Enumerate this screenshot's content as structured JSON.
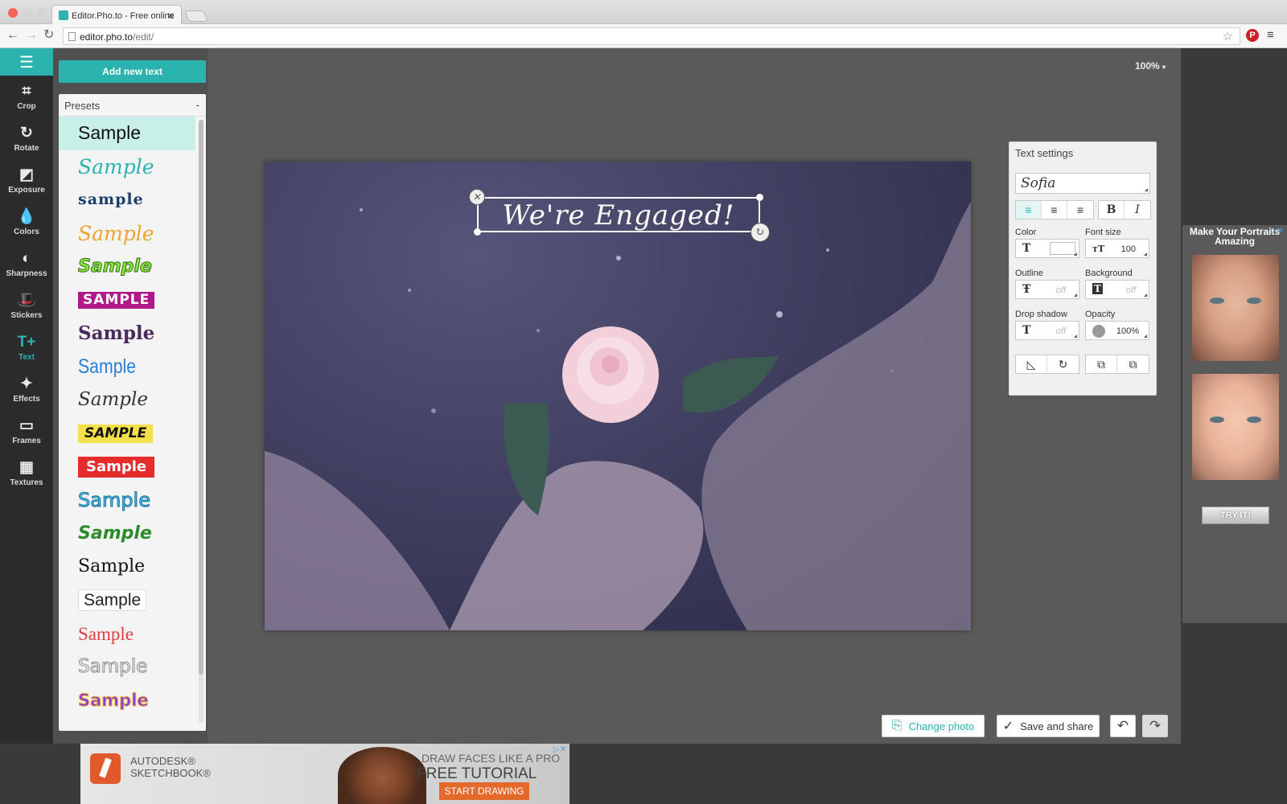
{
  "browser": {
    "tab_title": "Editor.Pho.to - Free online",
    "tab_close": "✕",
    "url_host": "editor.pho.to",
    "url_path": "/edit/"
  },
  "toolbar": {
    "menu_icon": "☰",
    "tools": [
      {
        "label": "Crop",
        "icon": "crop-icon",
        "glyph": "⌗"
      },
      {
        "label": "Rotate",
        "icon": "rotate-icon",
        "glyph": "↻"
      },
      {
        "label": "Exposure",
        "icon": "exposure-icon",
        "glyph": "◩"
      },
      {
        "label": "Colors",
        "icon": "droplet-icon",
        "glyph": "💧"
      },
      {
        "label": "Sharpness",
        "icon": "sharpness-icon",
        "glyph": "◐"
      },
      {
        "label": "Stickers",
        "icon": "hat-mustache-icon",
        "glyph": "🎩"
      },
      {
        "label": "Text",
        "icon": "text-plus-icon",
        "glyph": "T+"
      },
      {
        "label": "Effects",
        "icon": "magic-wand-icon",
        "glyph": "✦"
      },
      {
        "label": "Frames",
        "icon": "frame-icon",
        "glyph": "▭"
      },
      {
        "label": "Textures",
        "icon": "texture-icon",
        "glyph": "▦"
      }
    ]
  },
  "sidebar": {
    "add_text_label": "Add new text",
    "presets_title": "Presets",
    "collapse_icon": "-",
    "presets": [
      {
        "label": "Sample"
      },
      {
        "label": "Sample"
      },
      {
        "label": "sample"
      },
      {
        "label": "Sample"
      },
      {
        "label": "Sample"
      },
      {
        "label": "SAMPLE"
      },
      {
        "label": "Sample"
      },
      {
        "label": "Sample"
      },
      {
        "label": "Sample"
      },
      {
        "label": "SAMPLE"
      },
      {
        "label": "Sample"
      },
      {
        "label": "Sample"
      },
      {
        "label": "Sample"
      },
      {
        "label": "Sample"
      },
      {
        "label": "Sample"
      },
      {
        "label": "Sample"
      },
      {
        "label": "Sample"
      },
      {
        "label": "Sample"
      }
    ]
  },
  "canvas": {
    "zoom_label": "100%",
    "caption_text": "We're Engaged!"
  },
  "text_settings": {
    "title": "Text settings",
    "font": "Sofia",
    "bold_label": "B",
    "italic_label": "I",
    "color_label": "Color",
    "font_size_label": "Font size",
    "font_size_value": "100",
    "outline_label": "Outline",
    "outline_value": "off",
    "background_label": "Background",
    "background_value": "off",
    "drop_shadow_label": "Drop shadow",
    "drop_shadow_value": "off",
    "opacity_label": "Opacity",
    "opacity_value": "100%",
    "accent": "#2bb3b0"
  },
  "actions": {
    "change_photo_label": "Change photo",
    "save_share_label": "Save and share",
    "undo_icon": "↶",
    "redo_icon": "↷",
    "check_icon": "✓"
  },
  "ads": {
    "side_heading": "Make Your Portraits Amazing",
    "side_button": "TRY IT!",
    "bottom_brand": "AUTODESK® SKETCHBOOK®",
    "bottom_line1": "DRAW FACES LIKE A PRO",
    "bottom_line2": "FREE TUTORIAL",
    "bottom_cta": "START DRAWING",
    "ad_marker": "▷✕"
  }
}
